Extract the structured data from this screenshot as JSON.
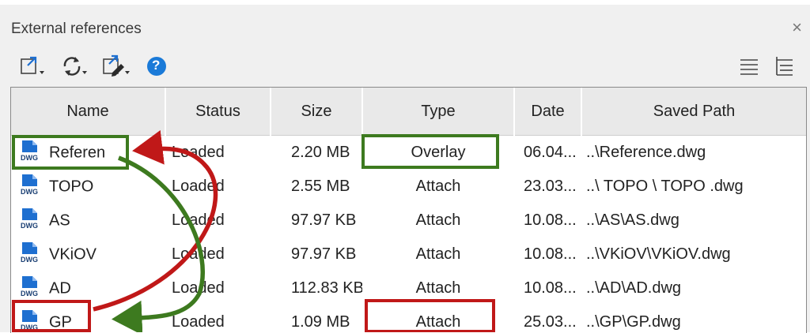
{
  "panel": {
    "title": "External references",
    "close_glyph": "×"
  },
  "toolbar": {
    "buttons": [
      {
        "name": "attach-icon",
        "has_dropdown": true
      },
      {
        "name": "refresh-icon",
        "has_dropdown": true
      },
      {
        "name": "change-path-icon",
        "has_dropdown": true
      },
      {
        "name": "help-icon",
        "has_dropdown": false
      }
    ],
    "help_glyph": "?",
    "view_buttons": [
      "list-view-icon",
      "tree-view-icon"
    ]
  },
  "table": {
    "columns": [
      "Name",
      "Status",
      "Size",
      "Type",
      "Date",
      "Saved Path"
    ],
    "file_icon_label": "DWG",
    "rows": [
      {
        "name": "Referen",
        "status": "Loaded",
        "size": "2.20 MB",
        "type": "Overlay",
        "date": "06.04...",
        "path": "..\\Reference.dwg"
      },
      {
        "name": "TOPO",
        "status": "Loaded",
        "size": "2.55 MB",
        "type": "Attach",
        "date": "23.03...",
        "path": "..\\ TOPO \\ TOPO .dwg"
      },
      {
        "name": "AS",
        "status": "Loaded",
        "size": "97.97 KB",
        "type": "Attach",
        "date": "10.08...",
        "path": "..\\AS\\AS.dwg"
      },
      {
        "name": "VKiOV",
        "status": "Loaded",
        "size": "97.97 KB",
        "type": "Attach",
        "date": "10.08...",
        "path": "..\\VKiOV\\VKiOV.dwg"
      },
      {
        "name": "AD",
        "status": "Loaded",
        "size": "112.83 KB",
        "type": "Attach",
        "date": "10.08...",
        "path": "..\\AD\\AD.dwg"
      },
      {
        "name": "GP",
        "status": "Loaded",
        "size": "1.09 MB",
        "type": "Attach",
        "date": "25.03...",
        "path": "..\\GP\\GP.dwg"
      }
    ]
  },
  "annotations": {
    "green": "#3d7a1f",
    "red": "#c01818"
  },
  "colors": {
    "dwg_blue": "#1e6fd0",
    "header_bg": "#e9e9e9",
    "help_blue": "#1a7ad8"
  }
}
